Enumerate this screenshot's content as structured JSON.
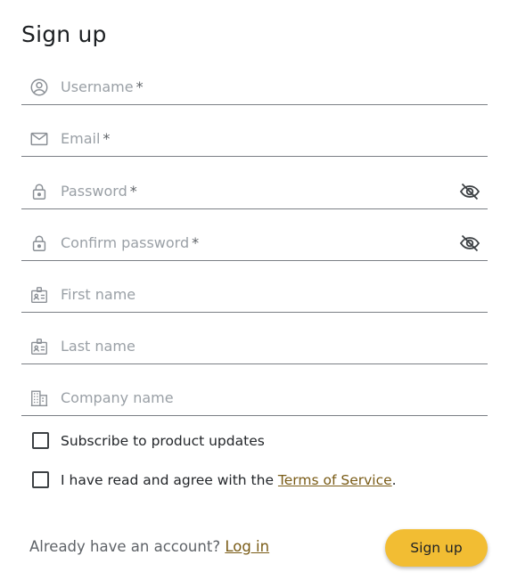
{
  "form": {
    "title": "Sign up",
    "required_mark": "*",
    "fields": [
      {
        "label": "Username",
        "value": "",
        "required": true,
        "icon": "account-circle-icon"
      },
      {
        "label": "Email",
        "value": "",
        "required": true,
        "icon": "mail-icon"
      },
      {
        "label": "Password",
        "value": "",
        "required": true,
        "icon": "lock-icon",
        "toggle_icon": "eye-off-icon"
      },
      {
        "label": "Confirm password",
        "value": "",
        "required": true,
        "icon": "lock-icon",
        "toggle_icon": "eye-off-icon"
      },
      {
        "label": "First name",
        "value": "",
        "required": false,
        "icon": "badge-icon"
      },
      {
        "label": "Last name",
        "value": "",
        "required": false,
        "icon": "badge-icon"
      },
      {
        "label": "Company name",
        "value": "",
        "required": false,
        "icon": "building-icon"
      }
    ],
    "checkboxes": {
      "subscribe": {
        "label": "Subscribe to product updates",
        "checked": false
      },
      "terms": {
        "label_before": "I have read and agree with the ",
        "link": "Terms of Service",
        "label_after": ".",
        "checked": false
      }
    },
    "footer": {
      "login_prompt": "Already have an account? ",
      "login_link": "Log in",
      "submit_label": "Sign up"
    }
  },
  "colors": {
    "accent_button": "#f2bd33",
    "link": "#7a5c17",
    "underline": "#7b7f85",
    "placeholder": "#9aa0a6"
  }
}
